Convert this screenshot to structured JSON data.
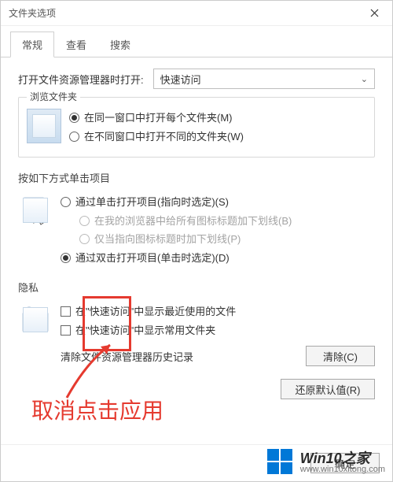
{
  "title": "文件夹选项",
  "tabs": [
    "常规",
    "查看",
    "搜索"
  ],
  "activeTab": 0,
  "openWith": {
    "label": "打开文件资源管理器时打开:",
    "value": "快速访问"
  },
  "browse": {
    "legend": "浏览文件夹",
    "opts": [
      {
        "label": "在同一窗口中打开每个文件夹(M)",
        "selected": true
      },
      {
        "label": "在不同窗口中打开不同的文件夹(W)",
        "selected": false
      }
    ]
  },
  "click": {
    "legend": "按如下方式单击项目",
    "opts": [
      {
        "label": "通过单击打开项目(指向时选定)(S)",
        "selected": false
      },
      {
        "label": "通过双击打开项目(单击时选定)(D)",
        "selected": true
      }
    ],
    "subs": [
      {
        "label": "在我的浏览器中给所有图标标题加下划线(B)"
      },
      {
        "label": "仅当指向图标标题时加下划线(P)"
      }
    ]
  },
  "privacy": {
    "legend": "隐私",
    "checks": [
      {
        "label": "在\"快速访问\"中显示最近使用的文件"
      },
      {
        "label": "在\"快速访问\"中显示常用文件夹"
      }
    ],
    "clear": {
      "text": "清除文件资源管理器历史记录",
      "btn": "清除(C)"
    }
  },
  "restore": "还原默认值(R)",
  "footer": {
    "ok": "确定"
  },
  "annotation": "取消点击应用",
  "watermark": {
    "brand": "Win10之家",
    "url": "www.win10xitong.com"
  }
}
